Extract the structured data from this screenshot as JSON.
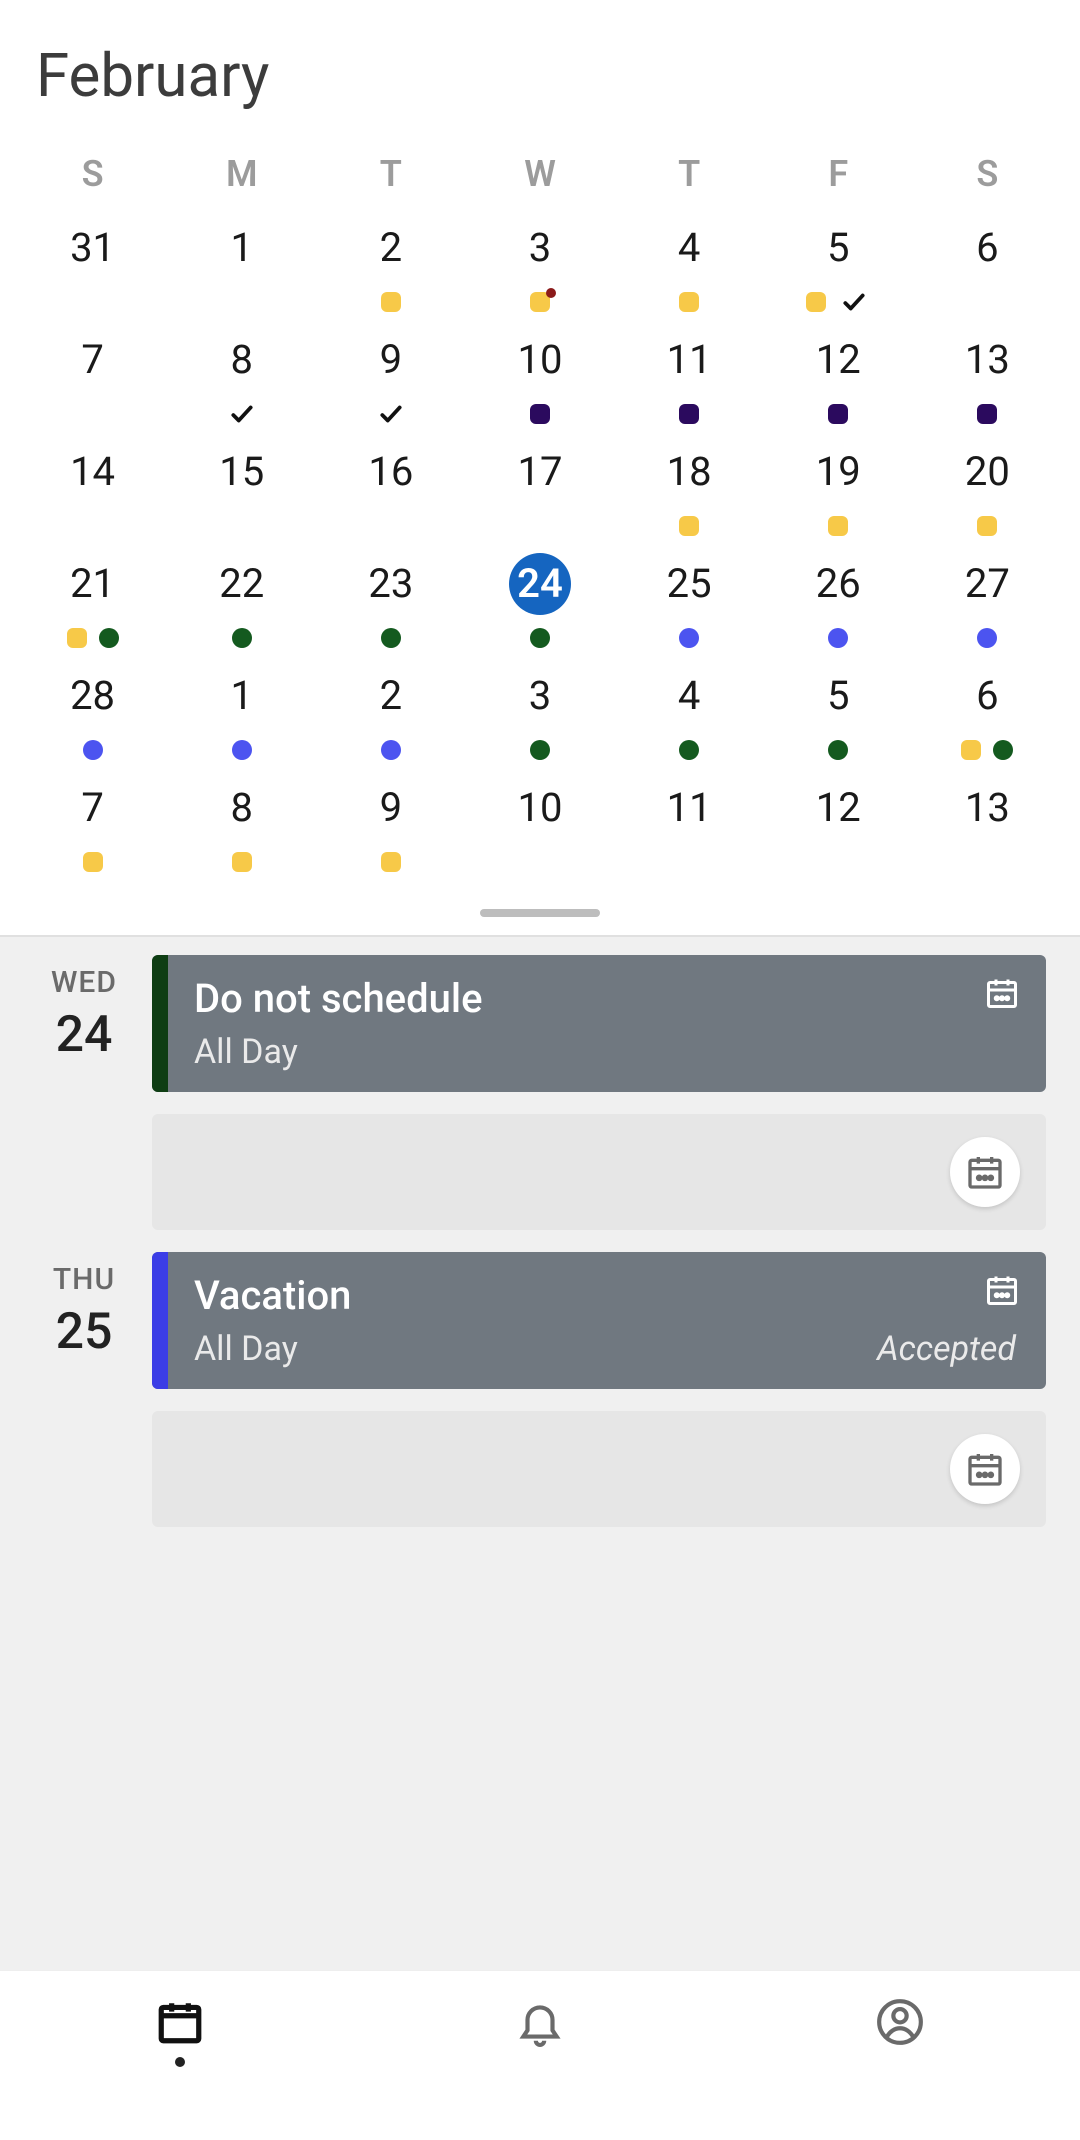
{
  "month_title": "February",
  "dow": [
    "S",
    "M",
    "T",
    "W",
    "T",
    "F",
    "S"
  ],
  "selected_day": "24",
  "weeks": [
    [
      {
        "n": "31",
        "dots": []
      },
      {
        "n": "1",
        "dots": []
      },
      {
        "n": "2",
        "dots": [
          "yellow"
        ]
      },
      {
        "n": "3",
        "dots": [
          "yellow-red"
        ]
      },
      {
        "n": "4",
        "dots": [
          "yellow"
        ]
      },
      {
        "n": "5",
        "dots": [
          "yellow",
          "check"
        ]
      },
      {
        "n": "6",
        "dots": []
      }
    ],
    [
      {
        "n": "7",
        "dots": []
      },
      {
        "n": "8",
        "dots": [
          "check"
        ]
      },
      {
        "n": "9",
        "dots": [
          "check"
        ]
      },
      {
        "n": "10",
        "dots": [
          "darkpurple"
        ]
      },
      {
        "n": "11",
        "dots": [
          "darkpurple"
        ]
      },
      {
        "n": "12",
        "dots": [
          "darkpurple"
        ]
      },
      {
        "n": "13",
        "dots": [
          "darkpurple"
        ]
      }
    ],
    [
      {
        "n": "14",
        "dots": []
      },
      {
        "n": "15",
        "dots": []
      },
      {
        "n": "16",
        "dots": []
      },
      {
        "n": "17",
        "dots": []
      },
      {
        "n": "18",
        "dots": [
          "yellow"
        ]
      },
      {
        "n": "19",
        "dots": [
          "yellow"
        ]
      },
      {
        "n": "20",
        "dots": [
          "yellow"
        ]
      }
    ],
    [
      {
        "n": "21",
        "dots": [
          "yellow",
          "green-circle"
        ]
      },
      {
        "n": "22",
        "dots": [
          "green-circle"
        ]
      },
      {
        "n": "23",
        "dots": [
          "green-circle"
        ]
      },
      {
        "n": "24",
        "dots": [
          "green-circle"
        ],
        "selected": true
      },
      {
        "n": "25",
        "dots": [
          "blue-circle"
        ]
      },
      {
        "n": "26",
        "dots": [
          "blue-circle"
        ]
      },
      {
        "n": "27",
        "dots": [
          "blue-circle"
        ]
      }
    ],
    [
      {
        "n": "28",
        "dots": [
          "blue-circle"
        ]
      },
      {
        "n": "1",
        "dots": [
          "blue-circle"
        ]
      },
      {
        "n": "2",
        "dots": [
          "blue-circle"
        ]
      },
      {
        "n": "3",
        "dots": [
          "green-circle"
        ]
      },
      {
        "n": "4",
        "dots": [
          "green-circle"
        ]
      },
      {
        "n": "5",
        "dots": [
          "green-circle"
        ]
      },
      {
        "n": "6",
        "dots": [
          "yellow",
          "green-circle"
        ]
      }
    ],
    [
      {
        "n": "7",
        "dots": [
          "yellow"
        ]
      },
      {
        "n": "8",
        "dots": [
          "yellow"
        ]
      },
      {
        "n": "9",
        "dots": [
          "yellow"
        ]
      },
      {
        "n": "10",
        "dots": []
      },
      {
        "n": "11",
        "dots": []
      },
      {
        "n": "12",
        "dots": []
      },
      {
        "n": "13",
        "dots": []
      }
    ]
  ],
  "agenda": [
    {
      "dow": "WED",
      "num": "24",
      "events": [
        {
          "title": "Do not schedule",
          "sub": "All Day",
          "status": "",
          "stripe": "green"
        }
      ],
      "empty_after": true
    },
    {
      "dow": "THU",
      "num": "25",
      "events": [
        {
          "title": "Vacation",
          "sub": "All Day",
          "status": "Accepted",
          "stripe": "blue"
        }
      ],
      "empty_after": true
    }
  ],
  "nav": {
    "calendar": "Calendar",
    "alerts": "Alerts",
    "profile": "Profile"
  }
}
